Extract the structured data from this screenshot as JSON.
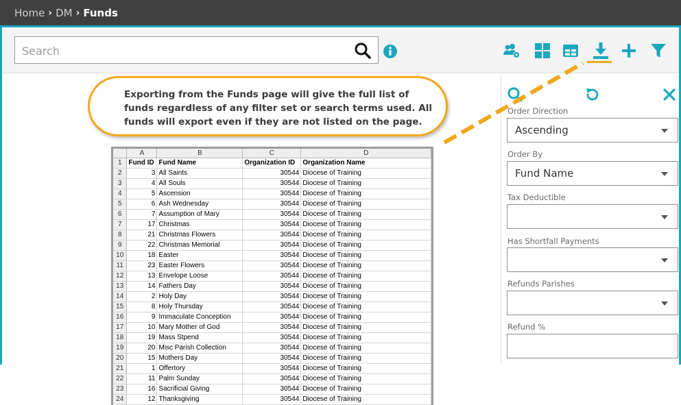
{
  "breadcrumb": {
    "items": [
      "Home",
      "DM"
    ],
    "current": "Funds"
  },
  "search": {
    "placeholder": "Search"
  },
  "panel": {
    "fields": [
      {
        "label": "Order Direction",
        "value": "Ascending",
        "type": "select"
      },
      {
        "label": "Order By",
        "value": "Fund Name",
        "type": "select"
      },
      {
        "label": "Tax Deductible",
        "value": "",
        "type": "select"
      },
      {
        "label": "Has Shortfall Payments",
        "value": "",
        "type": "select"
      },
      {
        "label": "Refunds Parishes",
        "value": "",
        "type": "select"
      },
      {
        "label": "Refund %",
        "value": "",
        "type": "input"
      }
    ]
  },
  "callout": {
    "text": "Exporting from the Funds page will give the full list of funds regardless of any filter set or search terms used. All funds will export even if they are not listed on the page."
  },
  "spreadsheet": {
    "column_letters": [
      "A",
      "B",
      "C",
      "D"
    ],
    "headers": [
      "Fund ID",
      "Fund Name",
      "Organization ID",
      "Organization Name"
    ],
    "rows": [
      [
        "3",
        "All Saints",
        "30544",
        "Diocese of Training"
      ],
      [
        "4",
        "All Souls",
        "30544",
        "Diocese of Training"
      ],
      [
        "5",
        "Ascension",
        "30544",
        "Diocese of Training"
      ],
      [
        "6",
        "Ash Wednesday",
        "30544",
        "Diocese of Training"
      ],
      [
        "7",
        "Assumption of Mary",
        "30544",
        "Diocese of Training"
      ],
      [
        "17",
        "Christmas",
        "30544",
        "Diocese of Training"
      ],
      [
        "21",
        "Christmas Flowers",
        "30544",
        "Diocese of Training"
      ],
      [
        "22",
        "Christmas Memorial",
        "30544",
        "Diocese of Training"
      ],
      [
        "18",
        "Easter",
        "30544",
        "Diocese of Training"
      ],
      [
        "23",
        "Easter Flowers",
        "30544",
        "Diocese of Training"
      ],
      [
        "13",
        "Envelope Loose",
        "30544",
        "Diocese of Training"
      ],
      [
        "14",
        "Fathers Day",
        "30544",
        "Diocese of Training"
      ],
      [
        "2",
        "Holy Day",
        "30544",
        "Diocese of Training"
      ],
      [
        "8",
        "Holy Thursday",
        "30544",
        "Diocese of Training"
      ],
      [
        "9",
        "Immaculate Conception",
        "30544",
        "Diocese of Training"
      ],
      [
        "10",
        "Mary Mother of God",
        "30544",
        "Diocese of Training"
      ],
      [
        "19",
        "Mass Stpend",
        "30544",
        "Diocese of Training"
      ],
      [
        "20",
        "Misc Parish Collection",
        "30544",
        "Diocese of Training"
      ],
      [
        "15",
        "Mothers Day",
        "30544",
        "Diocese of Training"
      ],
      [
        "1",
        "Offertory",
        "30544",
        "Diocese of Training"
      ],
      [
        "11",
        "Palm Sunday",
        "30544",
        "Diocese of Training"
      ],
      [
        "16",
        "Sacrificial Giving",
        "30544",
        "Diocese of Training"
      ],
      [
        "12",
        "Thanksgiving",
        "30544",
        "Diocese of Training"
      ]
    ]
  },
  "icons": {
    "toolbar": [
      "people-gear-icon",
      "grid-view-icon",
      "table-view-icon",
      "download-icon",
      "plus-icon",
      "filter-icon"
    ],
    "panel": [
      "search-icon",
      "reset-icon",
      "close-icon"
    ]
  },
  "colors": {
    "accent": "#1aa7bd",
    "highlight": "#f2a71b",
    "topbar": "#3f3f3f"
  }
}
